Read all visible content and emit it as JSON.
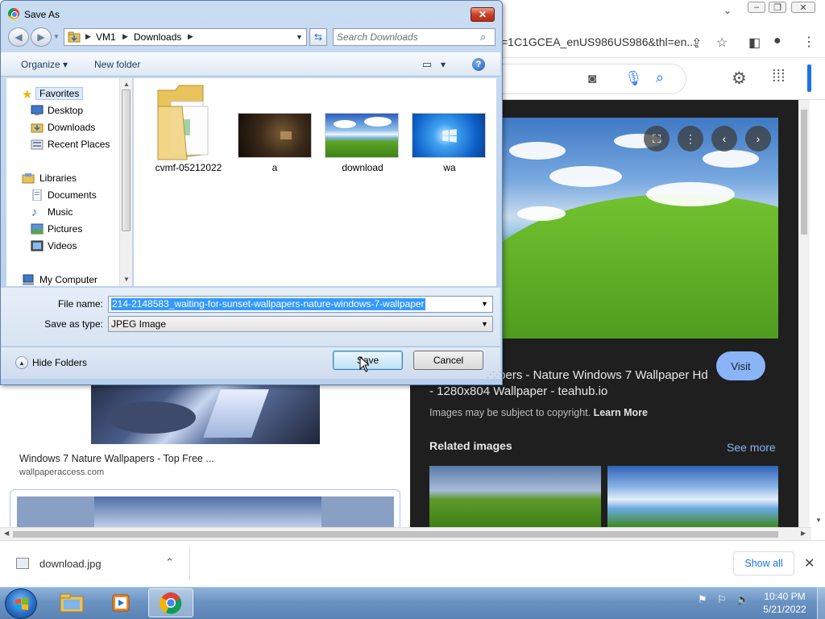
{
  "browser": {
    "url_fragment": "=1C1GCEA_enUS986US986&thl=en...",
    "right_panel": {
      "visit_label": "Visit",
      "title": "unset Wallpapers - Nature Windows 7 Wallpaper Hd - 1280x804 Wallpaper - teahub.io",
      "copyright_text": "Images may be subject to copyright.",
      "learn_more": "Learn More",
      "related_label": "Related images",
      "see_more": "See more"
    },
    "left_results": {
      "caption": "Windows 7 Nature Wallpapers - Top Free ...",
      "source": "wallpaperaccess.com"
    },
    "download_shelf": {
      "file_name": "download.jpg",
      "show_all": "Show all"
    }
  },
  "dialog": {
    "title": "Save As",
    "address": {
      "root": "VM1",
      "folder": "Downloads"
    },
    "search_placeholder": "Search Downloads",
    "toolbar": {
      "organize": "Organize",
      "new_folder": "New folder"
    },
    "nav": {
      "favorites": "Favorites",
      "desktop": "Desktop",
      "downloads": "Downloads",
      "recent_places": "Recent Places",
      "libraries": "Libraries",
      "documents": "Documents",
      "music": "Music",
      "pictures": "Pictures",
      "videos": "Videos",
      "my_computer": "My Computer"
    },
    "files": [
      {
        "name": "cvmf-05212022"
      },
      {
        "name": "a"
      },
      {
        "name": "download"
      },
      {
        "name": "wa"
      }
    ],
    "form": {
      "file_name_label": "File name:",
      "file_name_value": "214-2148583_waiting-for-sunset-wallpapers-nature-windows-7-wallpaper",
      "save_type_label": "Save as type:",
      "save_type_value": "JPEG Image"
    },
    "footer": {
      "hide_folders": "Hide Folders",
      "save": "Save",
      "cancel": "Cancel"
    }
  },
  "taskbar": {
    "time": "10:40 PM",
    "date": "5/21/2022"
  },
  "colors": {
    "selection": "#3399ff",
    "chrome_blue": "#8ab4f8",
    "link_blue": "#1a73e8"
  }
}
